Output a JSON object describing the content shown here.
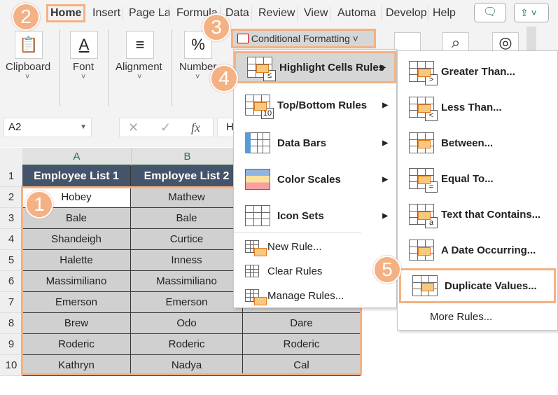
{
  "tabs": [
    "Home",
    "Insert",
    "Page La",
    "Formula",
    "Data",
    "Review",
    "View",
    "Automa",
    "Develop",
    "Help"
  ],
  "ribbon": {
    "groups": [
      {
        "label": "Clipboard",
        "icon": "clipboard-icon"
      },
      {
        "label": "Font",
        "icon": "font-color-icon"
      },
      {
        "label": "Alignment",
        "icon": "align-icon"
      },
      {
        "label": "Number",
        "icon": "percent-icon"
      }
    ],
    "cond_format": "Conditional Formatting",
    "cond_chev": "˅",
    "chev": "˅",
    "number_glyph": "%"
  },
  "formula_bar": {
    "name_box": "A2",
    "fx": "fx",
    "value": "H"
  },
  "sheet": {
    "columns": [
      "A",
      "B"
    ],
    "rows": [
      "1",
      "2",
      "3",
      "4",
      "5",
      "6",
      "7",
      "8",
      "9",
      "10"
    ],
    "headers": [
      "Employee List 1",
      "Employee List 2"
    ],
    "data": [
      [
        "Hobey",
        "Mathew",
        ""
      ],
      [
        "Bale",
        "Bale",
        ""
      ],
      [
        "Shandeigh",
        "Curtice",
        ""
      ],
      [
        "Halette",
        "Inness",
        ""
      ],
      [
        "Massimiliano",
        "Massimiliano",
        ""
      ],
      [
        "Emerson",
        "Emerson",
        ""
      ],
      [
        "Brew",
        "Odo",
        "Dare"
      ],
      [
        "Roderic",
        "Roderic",
        "Roderic"
      ],
      [
        "Kathryn",
        "Nadya",
        "Cal"
      ]
    ]
  },
  "menu": {
    "items": [
      "Highlight Cells Rules",
      "Top/Bottom Rules",
      "Data Bars",
      "Color Scales",
      "Icon Sets"
    ],
    "small": [
      "New Rule...",
      "Clear Rules",
      "Manage Rules..."
    ]
  },
  "submenu": {
    "items": [
      {
        "label": "Greater Than...",
        "glyph": ">"
      },
      {
        "label": "Less Than...",
        "glyph": "<"
      },
      {
        "label": "Between...",
        "glyph": ""
      },
      {
        "label": "Equal To...",
        "glyph": "="
      },
      {
        "label": "Text that Contains...",
        "glyph": "a"
      },
      {
        "label": "A Date Occurring...",
        "glyph": ""
      },
      {
        "label": "Duplicate Values...",
        "glyph": ""
      }
    ],
    "more": "More Rules..."
  },
  "badges": [
    "1",
    "2",
    "3",
    "4",
    "5"
  ],
  "colors": {
    "header_bg": "#44546a",
    "accent": "#f4b183",
    "selection": "#217346"
  }
}
